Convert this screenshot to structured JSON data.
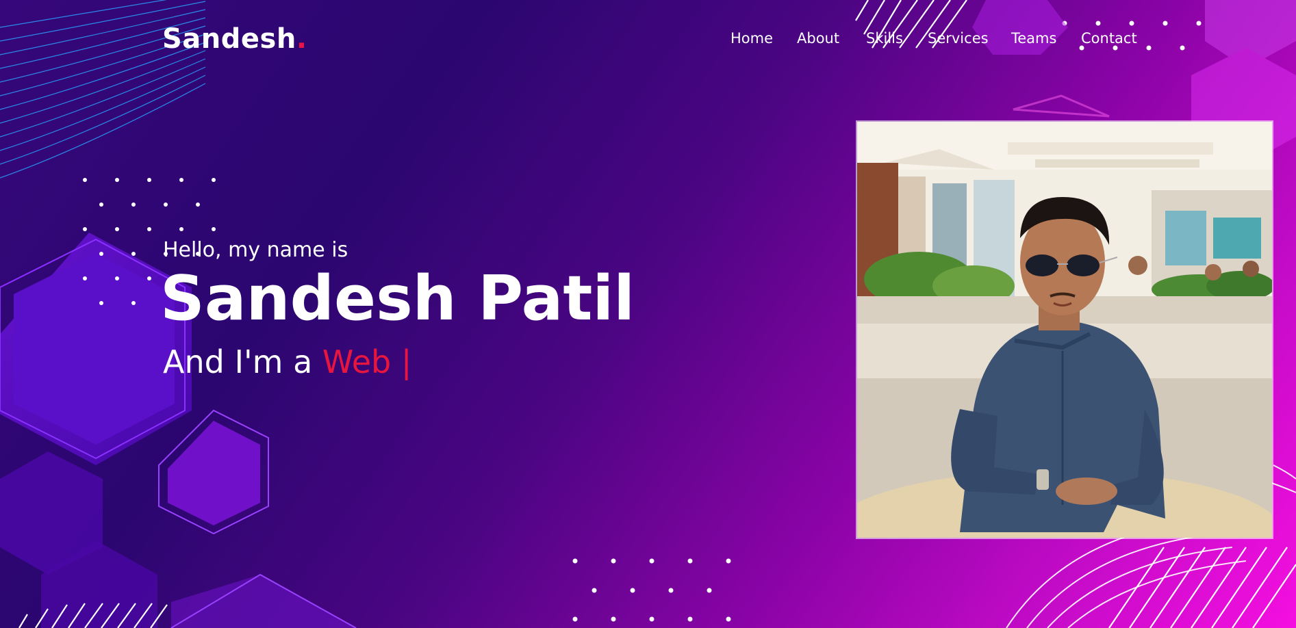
{
  "brand": {
    "name": "Sandesh",
    "dot": "."
  },
  "nav": {
    "items": [
      {
        "label": "Home"
      },
      {
        "label": "About"
      },
      {
        "label": "Skills"
      },
      {
        "label": "Services"
      },
      {
        "label": "Teams"
      },
      {
        "label": "Contact"
      }
    ]
  },
  "hero": {
    "greeting": "Hello, my name is",
    "name": "Sandesh Patil",
    "role_prefix": "And I'm a ",
    "role_typed": "Web ",
    "cursor": "|"
  },
  "photo": {
    "alt": "Portrait of Sandesh Patil wearing sunglasses and a denim shirt"
  },
  "colors": {
    "accent": "#e8163f",
    "bg_start": "#2b0670",
    "bg_end": "#f50fe0",
    "text": "#ffffff"
  }
}
